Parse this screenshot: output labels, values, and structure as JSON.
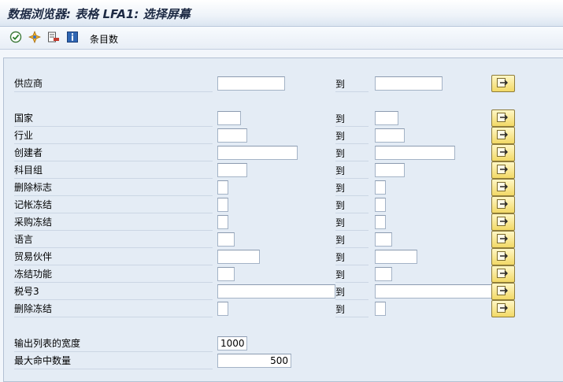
{
  "window": {
    "title": "数据浏览器: 表格 LFA1: 选择屏幕"
  },
  "toolbar": {
    "icons": [
      "execute-icon",
      "dynamic-selection-icon",
      "delete-selection-icon",
      "info-icon"
    ],
    "count_entries_label": "条目数"
  },
  "form": {
    "to_label": "到",
    "rows": [
      {
        "id": "vendor",
        "label": "供应商",
        "low": "",
        "high": ""
      },
      {
        "id": "country",
        "label": "国家",
        "low": "",
        "high": ""
      },
      {
        "id": "industry",
        "label": "行业",
        "low": "",
        "high": ""
      },
      {
        "id": "created-by",
        "label": "创建者",
        "low": "",
        "high": ""
      },
      {
        "id": "account-group",
        "label": "科目组",
        "low": "",
        "high": ""
      },
      {
        "id": "deletion-flag",
        "label": "删除标志",
        "low": "",
        "high": ""
      },
      {
        "id": "posting-block",
        "label": "记帐冻结",
        "low": "",
        "high": ""
      },
      {
        "id": "purchasing-block",
        "label": "采购冻结",
        "low": "",
        "high": ""
      },
      {
        "id": "language",
        "label": "语言",
        "low": "",
        "high": ""
      },
      {
        "id": "trading-partner",
        "label": "贸易伙伴",
        "low": "",
        "high": ""
      },
      {
        "id": "block-function",
        "label": "冻结功能",
        "low": "",
        "high": ""
      },
      {
        "id": "tax-number-3",
        "label": "税号3",
        "low": "",
        "high": ""
      },
      {
        "id": "deletion-block",
        "label": "删除冻结",
        "low": "",
        "high": ""
      }
    ],
    "output_width": {
      "label": "输出列表的宽度",
      "value": "1000"
    },
    "max_hits": {
      "label": "最大命中数量",
      "value": "500"
    }
  },
  "colors": {
    "background": "#f2f6fb",
    "form_panel": "#e4ecf5",
    "more_button": "#f2d966"
  }
}
